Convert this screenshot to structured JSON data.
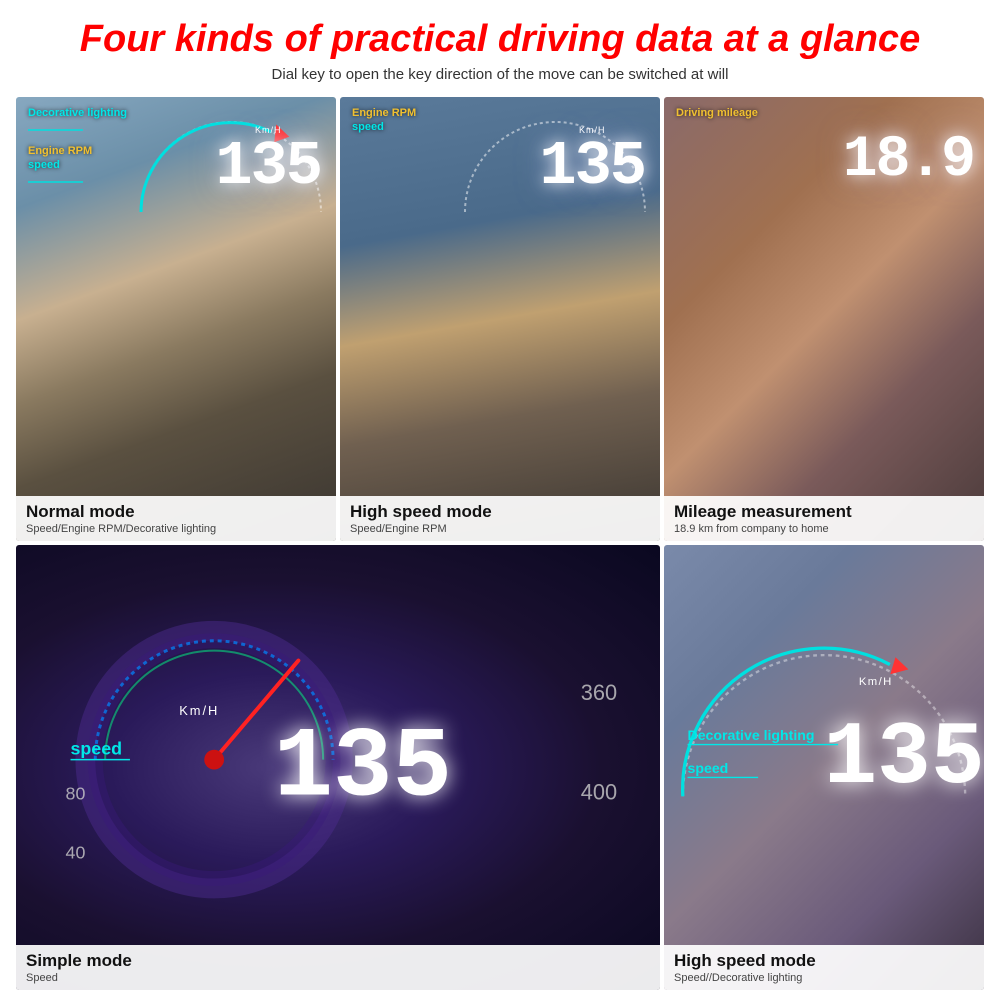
{
  "header": {
    "title": "Four kinds of practical driving data at a glance",
    "subtitle": "Dial key to open the key direction of the move can be switched at will"
  },
  "cells": [
    {
      "id": "normal-mode",
      "labels": [
        {
          "text": "Decorative lighting",
          "color": "cyan"
        },
        {
          "text": "Engine RPM",
          "color": "yellow"
        },
        {
          "text": "speed",
          "color": "cyan"
        }
      ],
      "kmh": "Km/H",
      "speed": "135",
      "caption_title": "Normal mode",
      "caption_sub": "Speed/Engine RPM/Decorative lighting"
    },
    {
      "id": "high-speed-mode-1",
      "labels": [
        {
          "text": "Engine RPM",
          "color": "yellow"
        },
        {
          "text": "speed",
          "color": "cyan"
        }
      ],
      "kmh": "Km/H",
      "speed": "135",
      "caption_title": "High speed mode",
      "caption_sub": "Speed/Engine RPM"
    },
    {
      "id": "mileage-mode",
      "labels": [
        {
          "text": "Driving mileage",
          "color": "yellow"
        }
      ],
      "kmh": "",
      "speed": "18.9",
      "caption_title": "Mileage measurement",
      "caption_sub": "18.9 km from company to home"
    },
    {
      "id": "simple-mode",
      "labels": [
        {
          "text": "speed",
          "color": "cyan"
        }
      ],
      "kmh": "Km/H",
      "speed": "135",
      "caption_title": "Simple mode",
      "caption_sub": "Speed"
    },
    {
      "id": "high-speed-mode-2",
      "labels": [
        {
          "text": "Decorative lighting",
          "color": "cyan"
        },
        {
          "text": "speed",
          "color": "cyan"
        }
      ],
      "kmh": "Km/H",
      "speed": "135",
      "caption_title": "High speed mode",
      "caption_sub": "Speed//Decorative lighting"
    }
  ]
}
